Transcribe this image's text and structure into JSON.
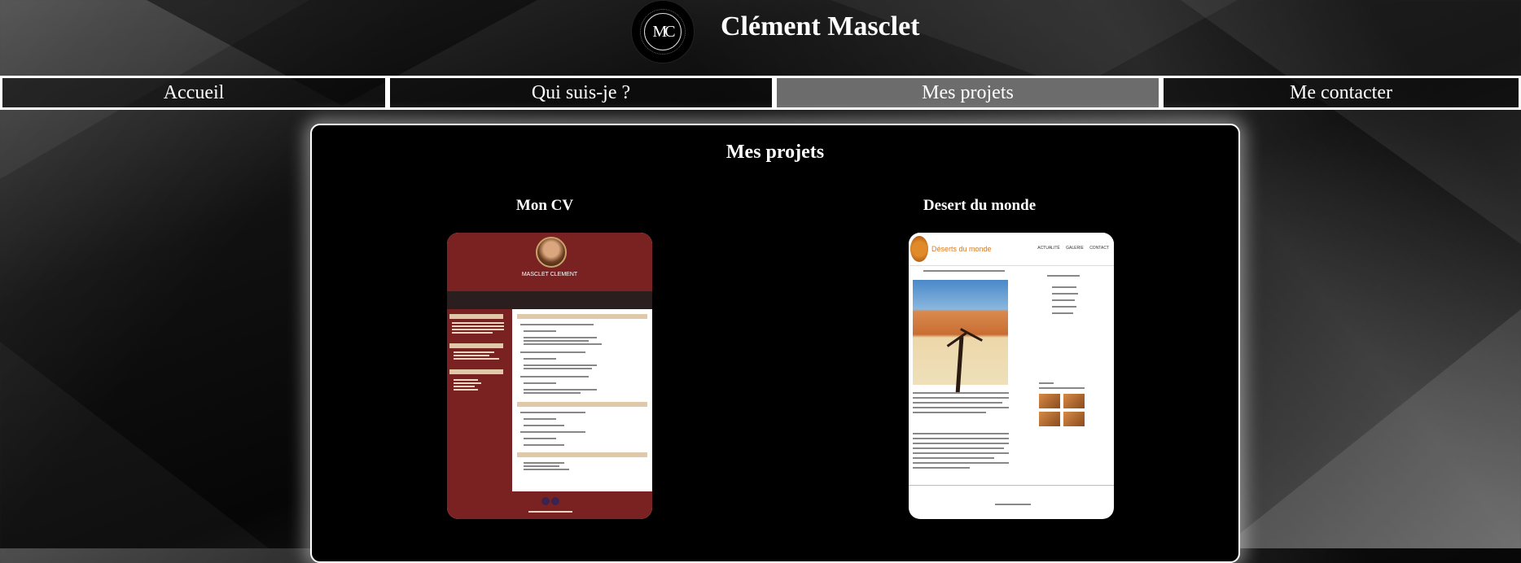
{
  "site": {
    "title": "Clément Masclet",
    "logo_text": "MC"
  },
  "nav": {
    "items": [
      "Accueil",
      "Qui suis-je ?",
      "Mes projets",
      "Me contacter"
    ],
    "active": "Mes projets"
  },
  "main": {
    "title": "Mes projets",
    "projects": [
      {
        "title": "Mon CV",
        "thumbnail": {
          "name": "MASCLET CLEMENT"
        }
      },
      {
        "title": "Desert du monde",
        "thumbnail": {
          "brand": "Déserts du monde",
          "links": "ACTUALITÉ GALERIE CONTACT"
        }
      }
    ]
  },
  "colors": {
    "accent_active_nav": "#6c6c6c",
    "cv_primary": "#7a2222",
    "desert_orange": "#e07a1a"
  }
}
